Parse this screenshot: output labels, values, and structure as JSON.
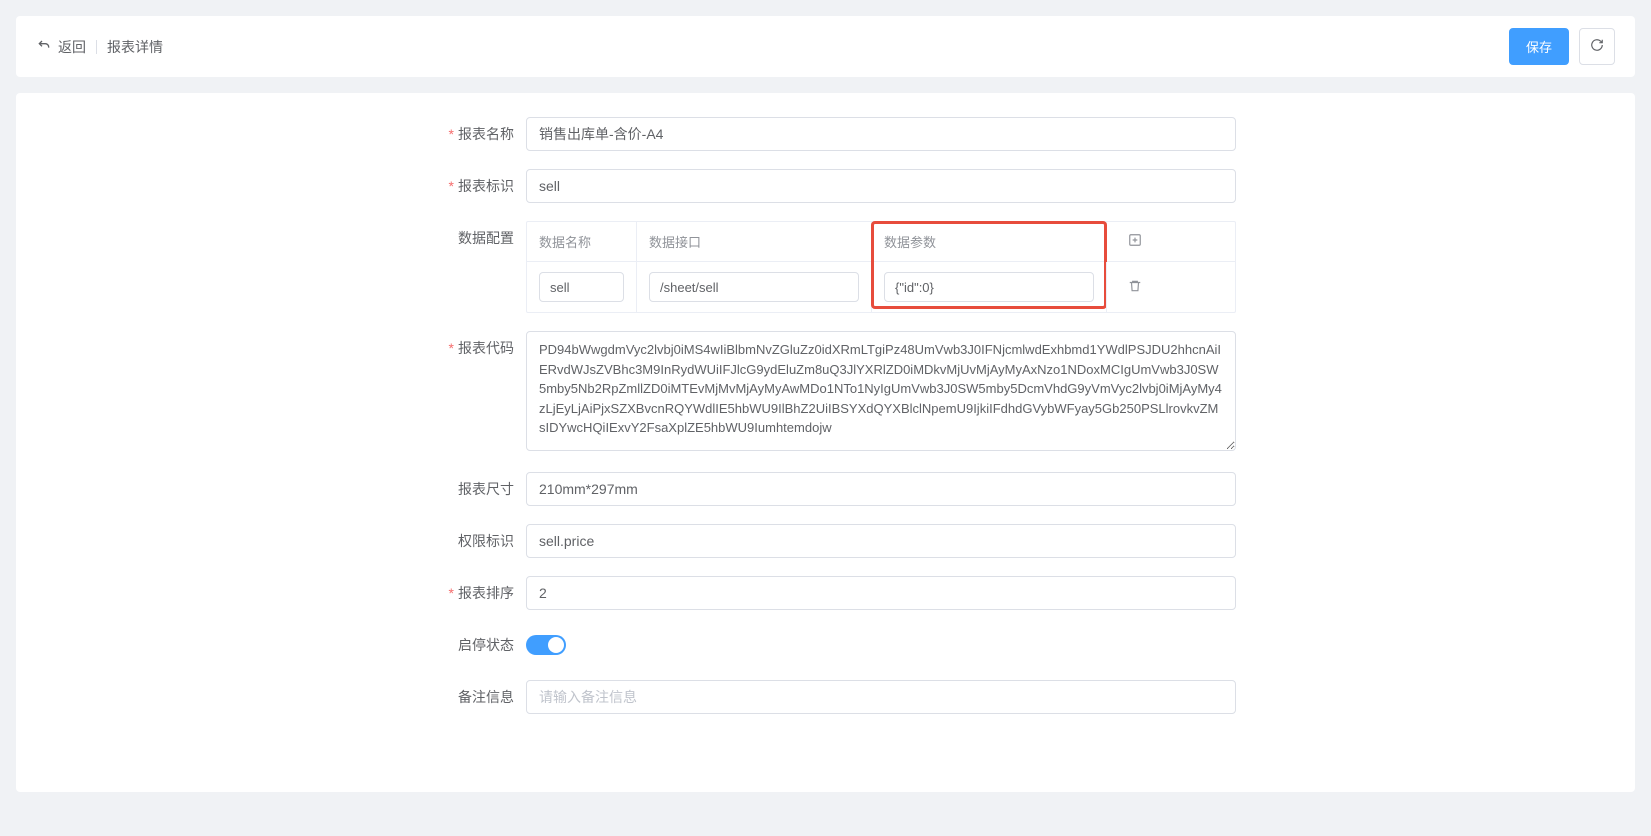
{
  "header": {
    "back_label": "返回",
    "title": "报表详情",
    "save_label": "保存"
  },
  "form": {
    "name": {
      "label": "报表名称",
      "value": "销售出库单-含价-A4"
    },
    "identifier": {
      "label": "报表标识",
      "value": "sell"
    },
    "data_config": {
      "label": "数据配置",
      "headers": {
        "name": "数据名称",
        "api": "数据接口",
        "params": "数据参数"
      },
      "row": {
        "name": "sell",
        "api": "/sheet/sell",
        "params": "{\"id\":0}"
      }
    },
    "code": {
      "label": "报表代码",
      "value": "PD94bWwgdmVyc2lvbj0iMS4wIiBlbmNvZGluZz0idXRmLTgiPz48UmVwb3J0IFNjcmlwdExhbmd1YWdlPSJDU2hhcnAiIERvdWJsZVBhc3M9InRydWUiIFJlcG9ydEluZm8uQ3JlYXRlZD0iMDkvMjUvMjAyMyAxNzo1NDoxMCIgUmVwb3J0SW5mby5Nb2RpZmllZD0iMTEvMjMvMjAyMyAwMDo1NTo1NyIgUmVwb3J0SW5mby5DcmVhdG9yVmVyc2lvbj0iMjAyMy4zLjEyLjAiPjxSZXBvcnRQYWdlIE5hbWU9IlBhZ2UiIBSYXdQYXBlclNpemU9IjkiIFdhdGVybWFyay5Gb250PSLlrovkvZMsIDYwcHQiIExvY2FsaXplZE5hbWU9Iumhtemdojw"
    },
    "size": {
      "label": "报表尺寸",
      "value": "210mm*297mm"
    },
    "permission": {
      "label": "权限标识",
      "value": "sell.price"
    },
    "sort": {
      "label": "报表排序",
      "value": "2"
    },
    "status": {
      "label": "启停状态",
      "enabled": true
    },
    "remark": {
      "label": "备注信息",
      "placeholder": "请输入备注信息",
      "value": ""
    }
  }
}
